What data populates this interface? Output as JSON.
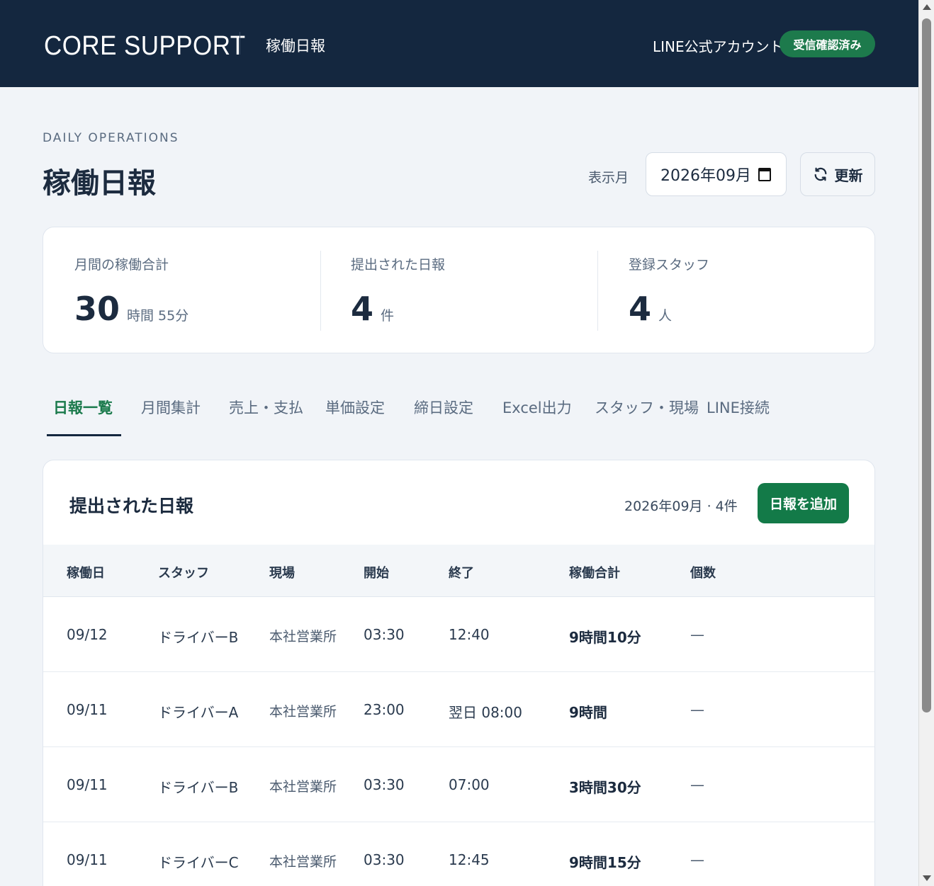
{
  "header": {
    "brand": "CORE SUPPORT",
    "title": "稼働日報",
    "line_account": "LINE公式アカウント",
    "line_status": "受信確認済み"
  },
  "page": {
    "eyebrow": "DAILY OPERATIONS",
    "title": "稼働日報",
    "month_label": "表示月",
    "month_value": "2026年09月",
    "refresh_label": "更新"
  },
  "stats": [
    {
      "label": "月間の稼働合計",
      "value": "30",
      "unit": "時間 55分"
    },
    {
      "label": "提出された日報",
      "value": "4",
      "unit": "件"
    },
    {
      "label": "登録スタッフ",
      "value": "4",
      "unit": "人"
    }
  ],
  "tabs": [
    {
      "label": "日報一覧",
      "active": true
    },
    {
      "label": "月間集計"
    },
    {
      "label": "売上・支払"
    },
    {
      "label": "単価設定"
    },
    {
      "label": "締日設定"
    },
    {
      "label": "Excel出力"
    },
    {
      "label": "スタッフ・現場"
    },
    {
      "label": "LINE接続"
    }
  ],
  "reports": {
    "title": "提出された日報",
    "meta": "2026年09月 · 4件",
    "add_button": "日報を追加",
    "columns": [
      "稼働日",
      "スタッフ",
      "現場",
      "開始",
      "終了",
      "稼働合計",
      "個数"
    ],
    "rows": [
      {
        "date": "09/12",
        "staff": "ドライバーB",
        "site": "本社営業所",
        "start": "03:30",
        "end": "12:40",
        "total": "9時間10分",
        "count": "—"
      },
      {
        "date": "09/11",
        "staff": "ドライバーA",
        "site": "本社営業所",
        "start": "23:00",
        "end": "翌日 08:00",
        "total": "9時間",
        "count": "—"
      },
      {
        "date": "09/11",
        "staff": "ドライバーB",
        "site": "本社営業所",
        "start": "03:30",
        "end": "07:00",
        "total": "3時間30分",
        "count": "—"
      },
      {
        "date": "09/11",
        "staff": "ドライバーC",
        "site": "本社営業所",
        "start": "03:30",
        "end": "12:45",
        "total": "9時間15分",
        "count": "—"
      }
    ]
  },
  "colors": {
    "header_bg": "#14273f",
    "accent_green": "#137a48",
    "active_tab": "#1a7a4c"
  }
}
